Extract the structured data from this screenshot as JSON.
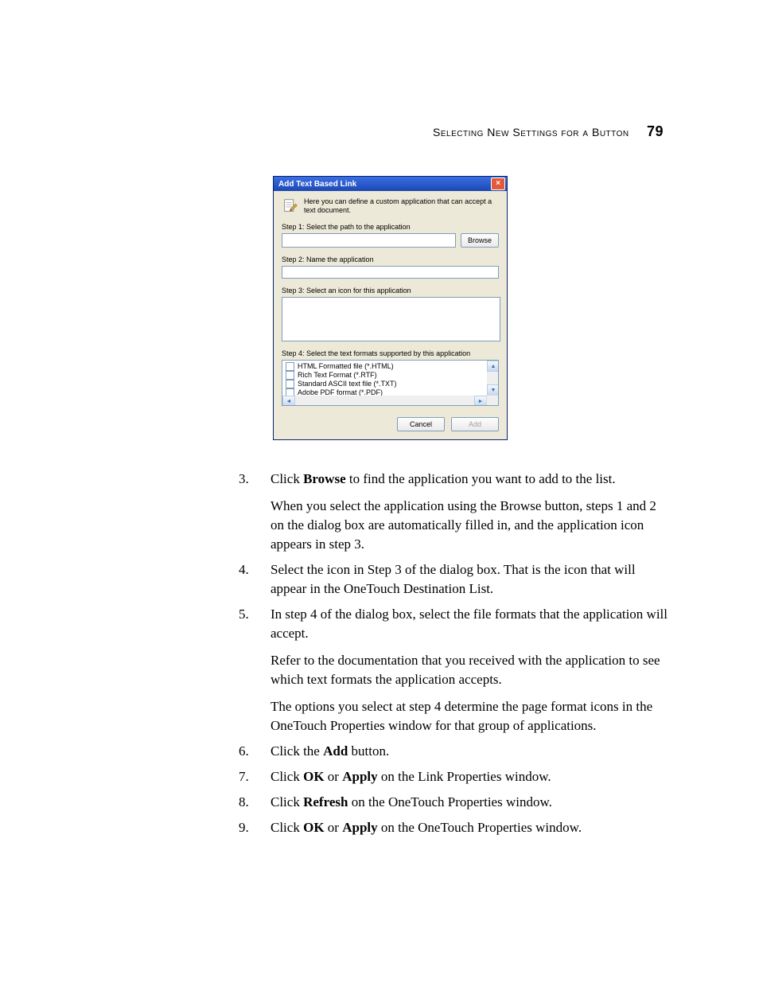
{
  "header": {
    "text": "Selecting New Settings for a Button",
    "page_number": "79"
  },
  "dialog": {
    "title": "Add Text Based Link",
    "intro": "Here you can define a custom application that can accept a text document.",
    "step1_label": "Step 1: Select the path to the application",
    "browse_label": "Browse",
    "step2_label": "Step 2: Name the application",
    "step3_label": "Step 3: Select an icon for this application",
    "step4_label": "Step 4: Select the text formats supported by this application",
    "formats": [
      "HTML Formatted file (*.HTML)",
      "Rich Text Format (*.RTF)",
      "Standard ASCII text file (*.TXT)",
      "Adobe PDF format (*.PDF)"
    ],
    "cancel_label": "Cancel",
    "add_label": "Add"
  },
  "steps": {
    "3": {
      "p1_a": "Click ",
      "p1_b": "Browse",
      "p1_c": " to find the application you want to add to the list.",
      "p2": "When you select the application using the Browse button, steps 1 and 2 on the dialog box are automatically filled in, and the application icon appears in step 3."
    },
    "4": {
      "p1": "Select the icon in Step 3 of the dialog box. That is the icon that will appear in the OneTouch Destination List."
    },
    "5": {
      "p1": "In step 4 of the dialog box, select the file formats that the application will accept.",
      "p2": "Refer to the documentation that you received with the application to see which text formats the application accepts.",
      "p3": "The options you select at step 4 determine the page format icons in the OneTouch Properties window for that group of applications."
    },
    "6": {
      "p1_a": "Click the ",
      "p1_b": "Add",
      "p1_c": " button."
    },
    "7": {
      "p1_a": "Click ",
      "p1_b": "OK",
      "p1_c": " or ",
      "p1_d": "Apply",
      "p1_e": " on the Link Properties window."
    },
    "8": {
      "p1_a": "Click ",
      "p1_b": "Refresh",
      "p1_c": " on the OneTouch Properties window."
    },
    "9": {
      "p1_a": "Click ",
      "p1_b": "OK",
      "p1_c": " or ",
      "p1_d": "Apply",
      "p1_e": " on the OneTouch Properties window."
    }
  }
}
